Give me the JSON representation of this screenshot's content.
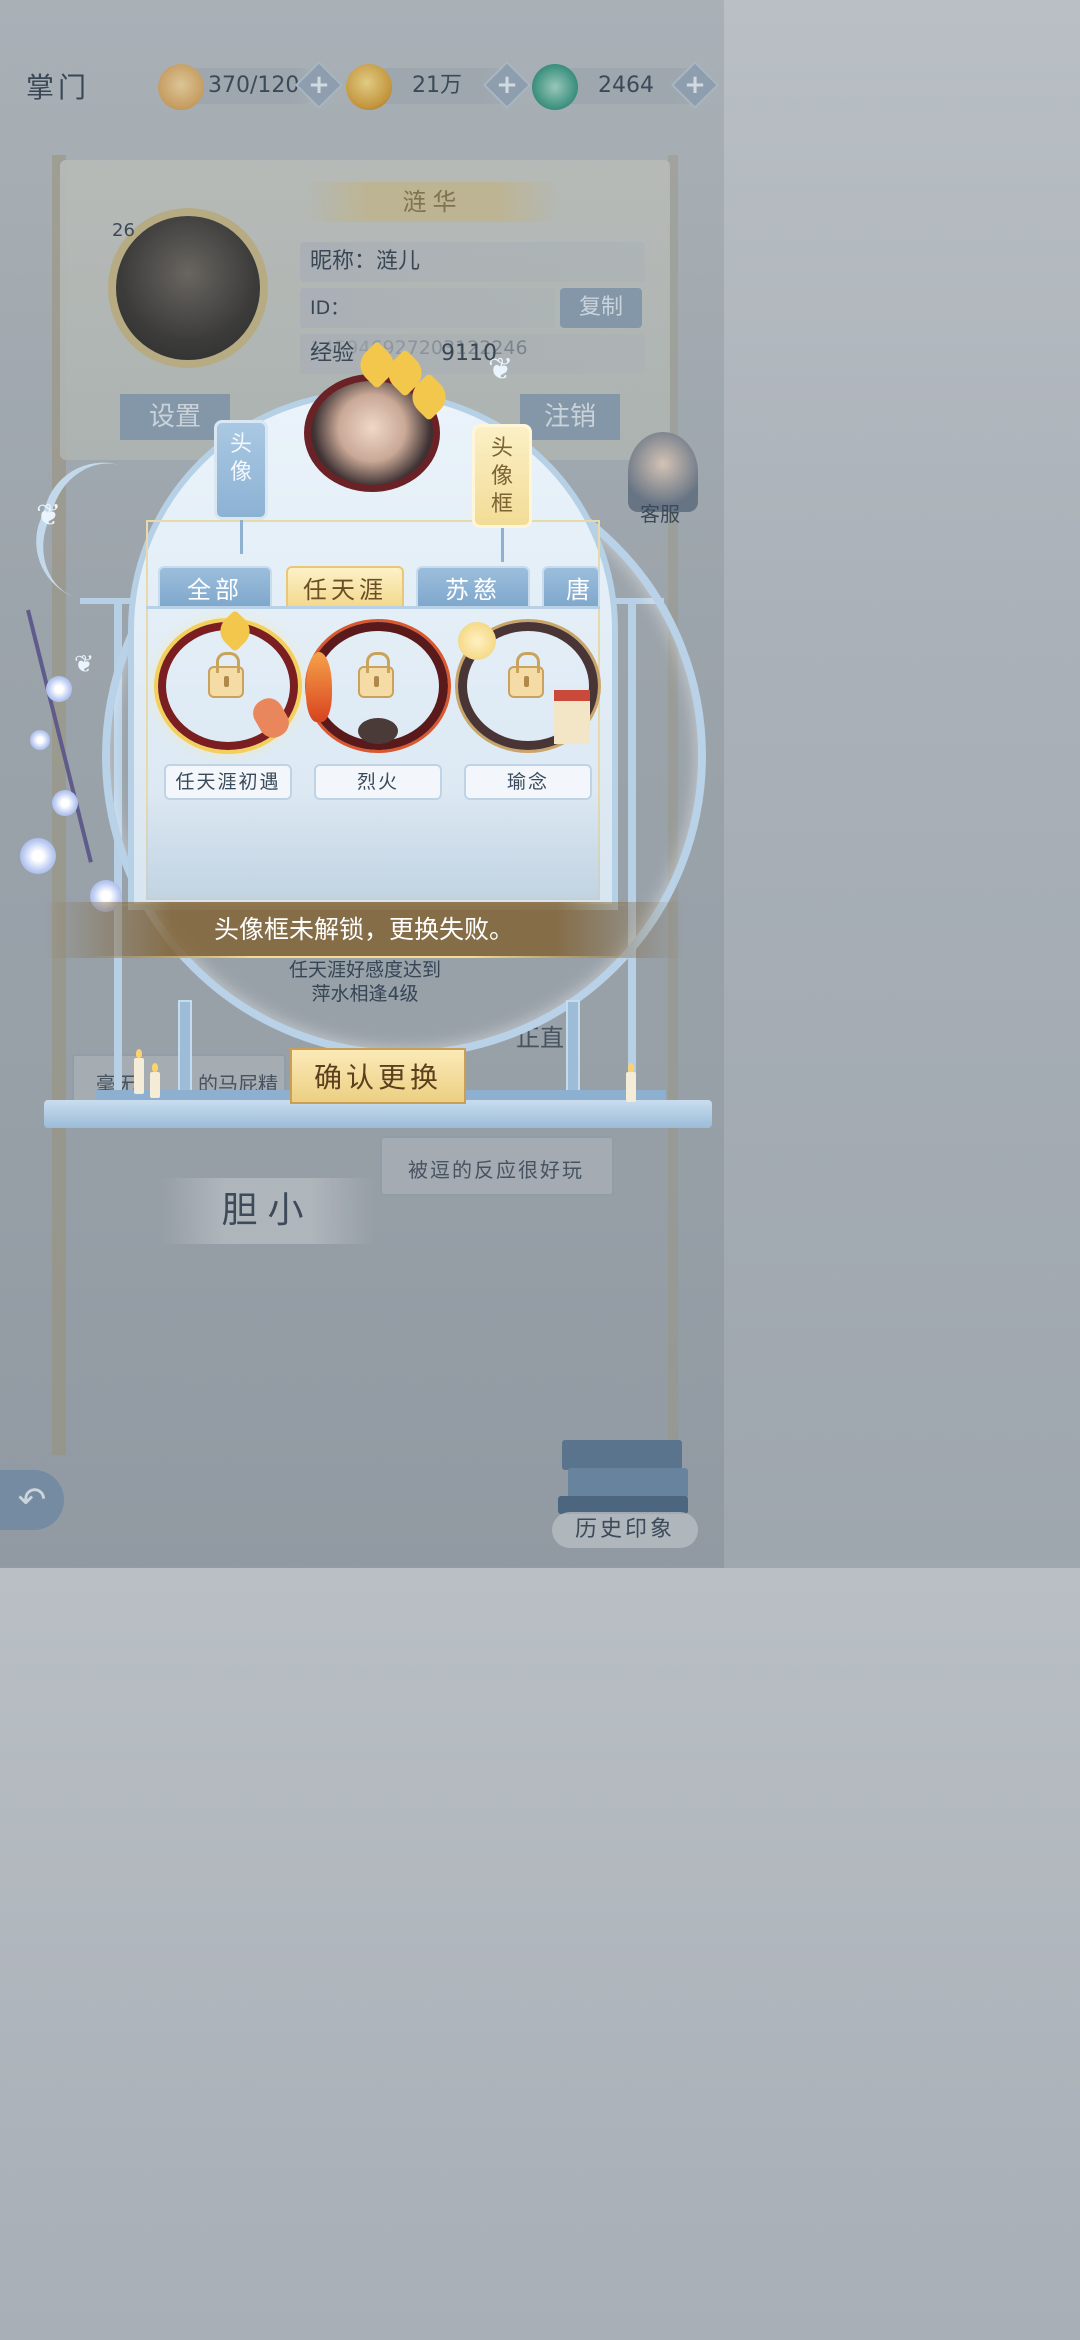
{
  "top_bar": {
    "title": "掌门",
    "stamina": "370/120",
    "coins": "21万",
    "jade": "2464",
    "plus_label": "+"
  },
  "profile": {
    "name": "涟华",
    "level": "26",
    "nickname_label": "昵称：涟儿",
    "id_label": "ID：145946927203122246",
    "copy_label": "复制",
    "exp_label": "经验",
    "exp_value": "9110",
    "settings_label": "设置",
    "logout_label": "注销",
    "customer_service": "客服"
  },
  "background_text": {
    "trait": "胆小",
    "comment1": "被逗的反应很好玩",
    "comment2": "毫无",
    "comment2b": "的马屁精",
    "comment3": "正直",
    "history": "历史印象"
  },
  "modal": {
    "hang_avatar": "头像",
    "hang_frame": "头像框",
    "tabs": [
      {
        "label": "全部"
      },
      {
        "label": "任天涯"
      },
      {
        "label": "苏慈"
      },
      {
        "label": "唐"
      }
    ],
    "frames": [
      {
        "label": "任天涯初遇"
      },
      {
        "label": "烈火"
      },
      {
        "label": "瑜念"
      }
    ],
    "toast": "头像框未解锁，更换失败。",
    "requirement_line1": "任天涯好感度达到",
    "requirement_line2": "萍水相逢4级",
    "confirm_label": "确认更换"
  },
  "colors": {
    "accent_gold": "#f2d98e",
    "accent_blue": "#9cbedc",
    "frame_red": "#6b2226"
  }
}
